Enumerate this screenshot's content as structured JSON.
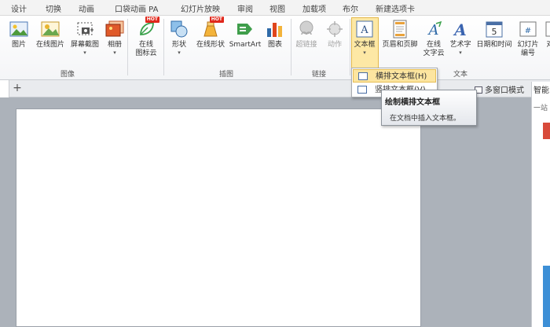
{
  "menu": {
    "items": [
      "设计",
      "切换",
      "动画",
      "口袋动画 PA",
      "幻灯片放映",
      "审阅",
      "视图",
      "加载项",
      "布尔",
      "新建选项卡"
    ]
  },
  "ribbon": {
    "image_group": {
      "label": "图像",
      "picture": "图片",
      "online_picture": "在线图片",
      "screenshot": "屏幕截图",
      "album": "相册"
    },
    "online_icon": {
      "label_line1": "在线",
      "label_line2": "图标云",
      "badge": "HOT"
    },
    "illustration_group": {
      "label": "插图",
      "shapes": "形状",
      "online_shapes": "在线形状",
      "online_shapes_badge": "HOT",
      "smartart": "SmartArt",
      "chart": "图表"
    },
    "link_group": {
      "label": "链接",
      "hyperlink": "超链接",
      "action": "动作"
    },
    "text_group": {
      "label": "文本",
      "textbox": "文本框",
      "header_footer": "页眉和页脚",
      "online_text_line1": "在线",
      "online_text_line2": "文字云",
      "wordart": "艺术字",
      "datetime": "日期和时间",
      "slide_number_line1": "幻灯片",
      "slide_number_line2": "编号",
      "object": "对"
    }
  },
  "toolbar2": {
    "add_tab": "+",
    "multi_window": "多窗口模式"
  },
  "sidepanel": {
    "header": "智能",
    "sub": "一站"
  },
  "dropdown": {
    "items": [
      "横排文本框(H)",
      "竖排文本框(V)"
    ]
  },
  "tooltip": {
    "title": "绘制横排文本框",
    "desc": "在文档中插入文本框。"
  },
  "colors": {
    "highlight": "#fce5a0",
    "hot_badge": "#e0281c"
  }
}
